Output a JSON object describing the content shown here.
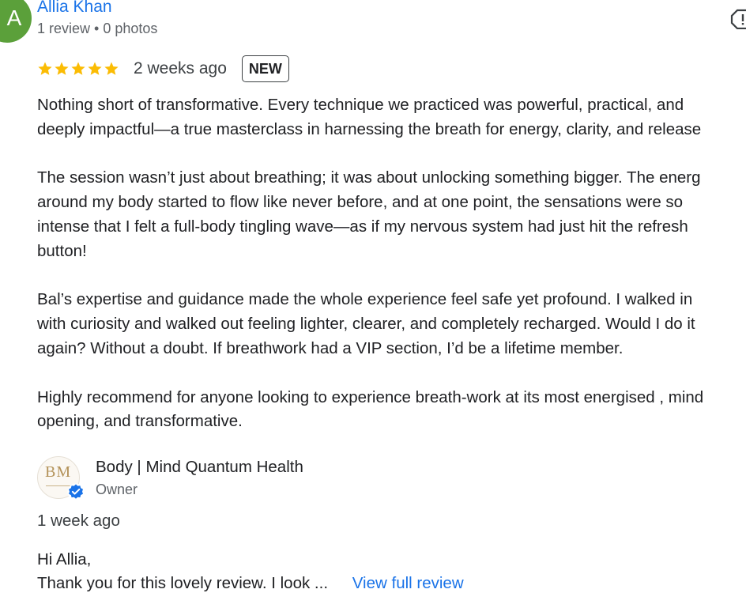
{
  "reviewer": {
    "initial": "A",
    "name": "Allia Khan",
    "meta": "1 review • 0 photos",
    "avatar_color": "#5ba03a"
  },
  "report_icon": "flag-icon",
  "rating": {
    "stars": 5,
    "max_stars": 5,
    "star_color": "#fbbc04",
    "date": "2 weeks ago",
    "badge": "NEW"
  },
  "review": {
    "paragraphs": [
      [
        "Nothing short of transformative. Every technique we practiced was powerful, practical, and",
        "deeply impactful—a true masterclass in harnessing the breath for energy, clarity, and release"
      ],
      [
        "The session wasn’t just about breathing; it was about unlocking something bigger. The energ",
        "around my body started to flow like never before, and at one point, the sensations were so",
        "intense that I felt a full-body tingling wave—as if my nervous system had just hit the refresh",
        "button!"
      ],
      [
        "Bal’s expertise and guidance made the whole experience feel safe yet profound. I walked in",
        "with curiosity and walked out feeling lighter, clearer, and completely recharged. Would I do it",
        "again? Without a doubt. If breathwork had a VIP section, I’d be a lifetime member."
      ],
      [
        "Highly recommend for anyone looking to experience breath-work at its most energised , mind",
        "opening, and transformative."
      ]
    ]
  },
  "owner_reply": {
    "logo_text": "BM",
    "name": "Body | Mind Quantum Health",
    "role": "Owner",
    "verified_color": "#1a73e8",
    "date": "1 week ago",
    "greeting": "Hi Allia,",
    "preview": "Thank you for this lovely review. I look ...",
    "view_full_label": "View full review",
    "link_color": "#1a73e8"
  }
}
